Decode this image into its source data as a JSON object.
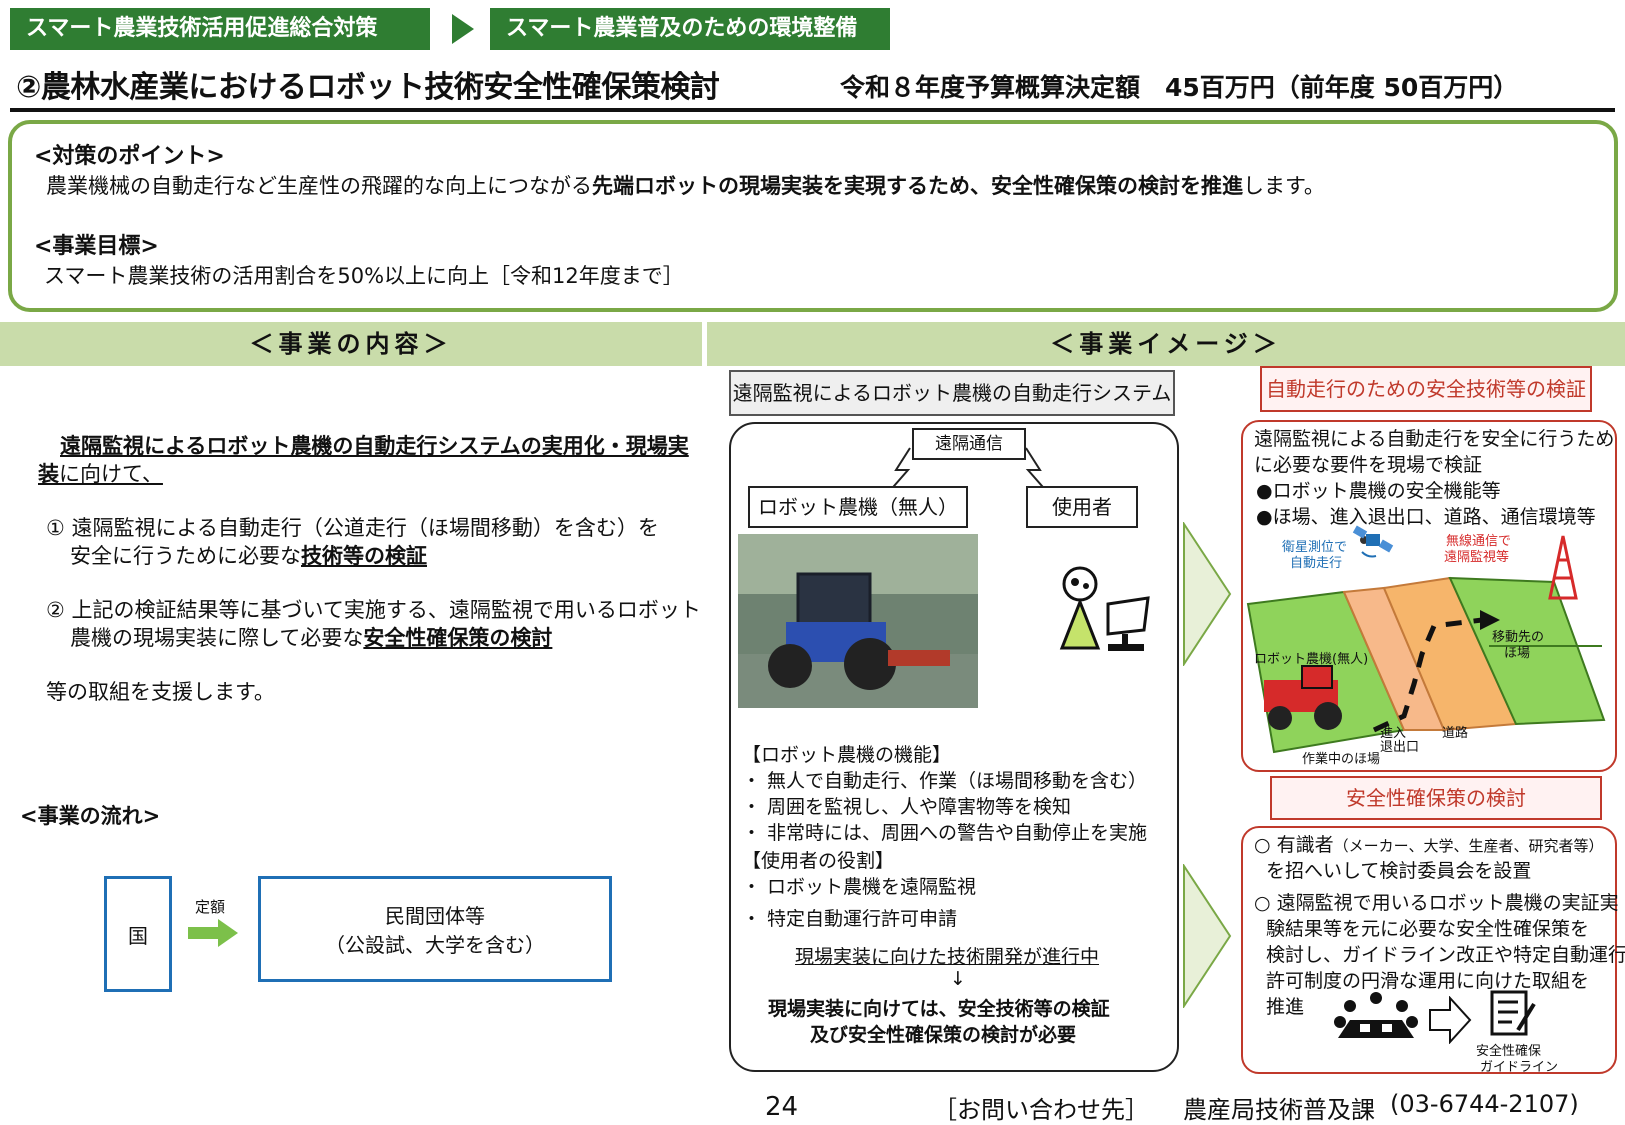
{
  "header": {
    "tag1": "スマート農業技術活用促進総合対策",
    "tag2": "スマート農業普及のための環境整備",
    "title": "②農林水産業におけるロボット技術安全性確保策検討",
    "budget": "令和８年度予算概算決定額　45百万円（前年度 50百万円）"
  },
  "points": {
    "heading": "<対策のポイント>",
    "text_pre": "農業機械の自動走行など生産性の飛躍的な向上につながる",
    "text_bold": "先端ロボットの現場実装を実現するため、安全性確保策の検討を推進",
    "text_post": "します。",
    "goal_heading": "<事業目標>",
    "goal_text": "スマート農業技術の活用割合を50%以上に向上［令和12年度まで］"
  },
  "sections": {
    "left": "＜事業の内容＞",
    "right": "＜事業イメージ＞"
  },
  "content": {
    "intro_bold1": "遠隔監視によるロボット農機の自動走行システムの実用化・現場実",
    "intro_bold2": "装",
    "intro_tail": "に向けて、",
    "item1_line1": "① 遠隔監視による自動走行（公道走行（ほ場間移動）を含む）を",
    "item1_line2_pre": "安全に行うために必要な",
    "item1_line2_bold": "技術等の検証",
    "item2_line1": "② 上記の検証結果等に基づいて実施する、遠隔監視で用いるロボット",
    "item2_line2_pre": "農機の現場実装に際して必要な",
    "item2_line2_bold": "安全性確保策の検討",
    "closing": "等の取組を支援します。"
  },
  "flow": {
    "heading": "<事業の流れ>",
    "country": "国",
    "arrow_label": "定額",
    "recipient_line1": "民間団体等",
    "recipient_line2": "（公設試、大学を含む）"
  },
  "system": {
    "title": "遠隔監視によるロボット農機の自動走行システム",
    "remote_comm": "遠隔通信",
    "robot_label": "ロボット農機（無人）",
    "user_label": "使用者",
    "functions_heading": "【ロボット農機の機能】",
    "functions": [
      "・ 無人で自動走行、作業（ほ場間移動を含む）",
      "・ 周囲を監視し、人や障害物等を検知",
      "・ 非常時には、周囲への警告や自動停止を実施"
    ],
    "roles_heading": "【使用者の役割】",
    "roles": [
      "・ ロボット農機を遠隔監視",
      "・ 特定自動運行許可申請"
    ],
    "dev_note": "現場実装に向けた技術開発が進行中",
    "down_arrow": "↓",
    "conclusion1": "現場実装に向けては、安全技術等の検証",
    "conclusion2": "及び安全性確保策の検討が必要"
  },
  "verification": {
    "title": "自動走行のための安全技術等の検証",
    "line1": "遠隔監視による自動走行を安全に行うため",
    "line2": "に必要な要件を現場で検証",
    "bullet1": "●ロボット農機の安全機能等",
    "bullet2": "●ほ場、進入退出口、道路、通信環境等",
    "gnss1": "衛星測位で",
    "gnss2": "自動走行",
    "radio1": "無線通信で",
    "radio2": "遠隔監視等",
    "dest1": "移動先の",
    "dest2": "ほ場",
    "robot": "ロボット農機(無人)",
    "field": "作業中のほ場",
    "entry1": "進入",
    "entry2": "退出口",
    "road": "道路"
  },
  "safety": {
    "title": "安全性確保策の検討",
    "item1_pre": "○ 有識者",
    "item1_small": "（メーカー、大学、生産者、研究者等）",
    "item1_line2": "を招へいして検討委員会を設置",
    "item2_lines": [
      "○ 遠隔監視で用いるロボット農機の実証実",
      "験結果等を元に必要な安全性確保策を",
      "検討し、ガイドライン改正や特定自動運行",
      "許可制度の円滑な運用に向けた取組を",
      "推進"
    ],
    "guideline1": "安全性確保",
    "guideline2": "ガイドライン"
  },
  "footer": {
    "page": "24",
    "contact_label": "［お問い合わせ先］",
    "department": "農産局技術普及課",
    "phone": "(03-6744-2107)"
  },
  "colors": {
    "green_dark": "#2f7d32",
    "green_border": "#7aa846",
    "section_bar": "#c9dcaa",
    "red": "#c0392b",
    "blue": "#1f6fb5"
  }
}
